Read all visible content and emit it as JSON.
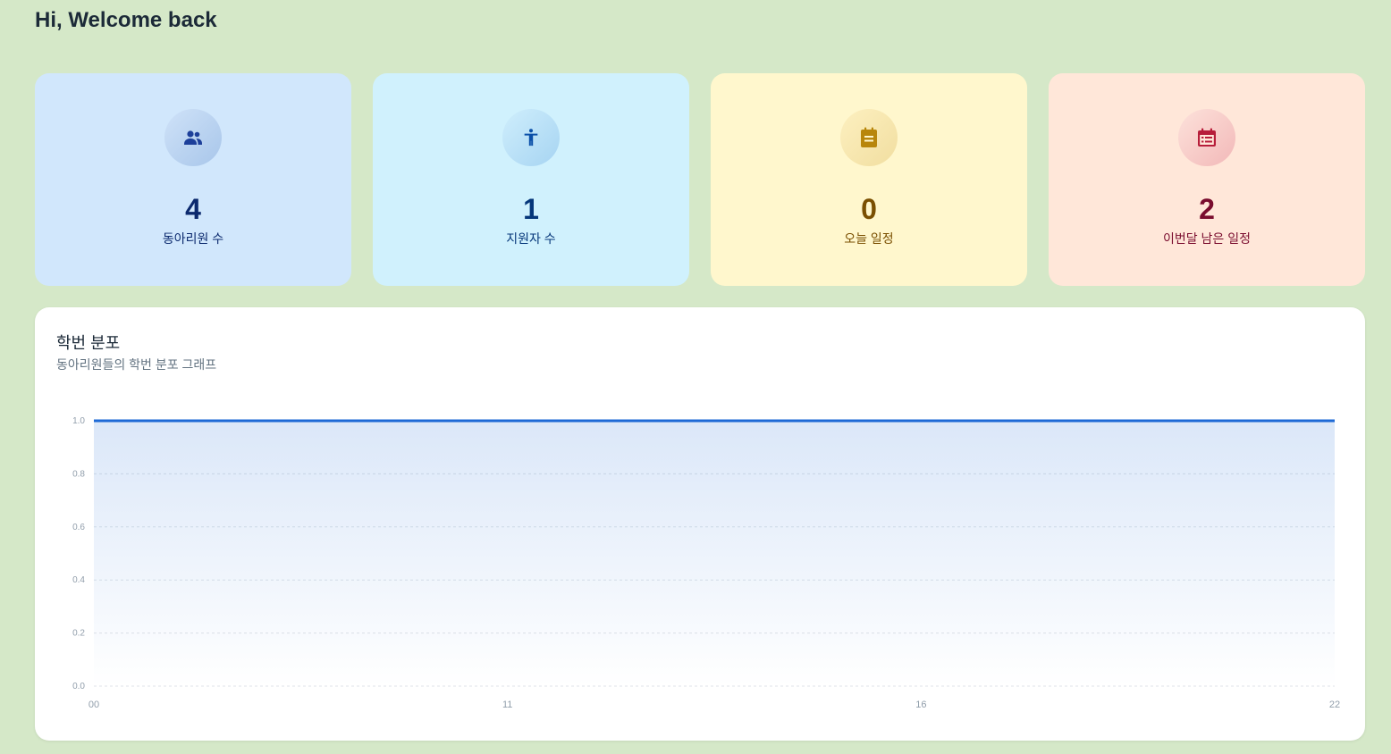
{
  "header": {
    "greeting": "Hi, Welcome back"
  },
  "stats": [
    {
      "key": "members",
      "value": "4",
      "label": "동아리원 수",
      "icon": "people-icon",
      "color": "#0c2a6e"
    },
    {
      "key": "applicants",
      "value": "1",
      "label": "지원자 수",
      "icon": "accessibility-icon",
      "color": "#06377a"
    },
    {
      "key": "today",
      "value": "0",
      "label": "오늘 일정",
      "icon": "notepad-icon",
      "color": "#7a4f01"
    },
    {
      "key": "month",
      "value": "2",
      "label": "이번달 남은 일정",
      "icon": "calendar-icon",
      "color": "#7a0c2e"
    }
  ],
  "chart": {
    "title": "학번 분포",
    "subtitle": "동아리원들의 학번 분포 그래프",
    "line_color": "#1e6ad6"
  },
  "chart_data": {
    "type": "area",
    "title": "학번 분포",
    "subtitle": "동아리원들의 학번 분포 그래프",
    "xlabel": "",
    "ylabel": "",
    "x": [
      "00",
      "11",
      "16",
      "22"
    ],
    "series": [
      {
        "values": [
          1,
          1,
          1,
          1
        ]
      }
    ],
    "ylim": [
      0,
      1
    ],
    "yticks": [
      "0.0",
      "0.2",
      "0.4",
      "0.6",
      "0.8",
      "1.0"
    ],
    "grid": true
  }
}
